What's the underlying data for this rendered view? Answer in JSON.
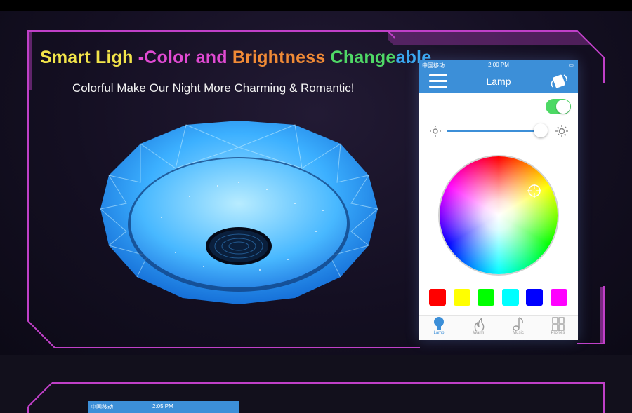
{
  "headline": {
    "seg1": "Smart Ligh",
    "seg2": " -Color and ",
    "seg3": "Brightness ",
    "seg4": "Change",
    "seg5": "able"
  },
  "subheadline": "Colorful Make Our Night More Charming & Romantic!",
  "phone": {
    "status": {
      "carrier": "中国移动",
      "time": "2:00 PM"
    },
    "title": "Lamp",
    "power_on": true,
    "brightness_fraction": 0.98,
    "presets": [
      "#ff0000",
      "#ffff00",
      "#00ff00",
      "#00ffff",
      "#0000ff",
      "#ff00ff"
    ],
    "tabs": [
      {
        "label": "Lamp",
        "icon": "bulb-icon",
        "active": true
      },
      {
        "label": "Warm",
        "icon": "flame-icon",
        "active": false
      },
      {
        "label": "Music",
        "icon": "music-note-icon",
        "active": false
      },
      {
        "label": "Profiles",
        "icon": "grid-icon",
        "active": false
      }
    ],
    "accent": "#3c8fd8"
  },
  "lower_phone": {
    "carrier": "中国移动",
    "time": "2:05 PM"
  },
  "colors": {
    "frame": "#c040c8",
    "toggle_on": "#4cd964",
    "lamp_glow": "#38a8ff"
  }
}
